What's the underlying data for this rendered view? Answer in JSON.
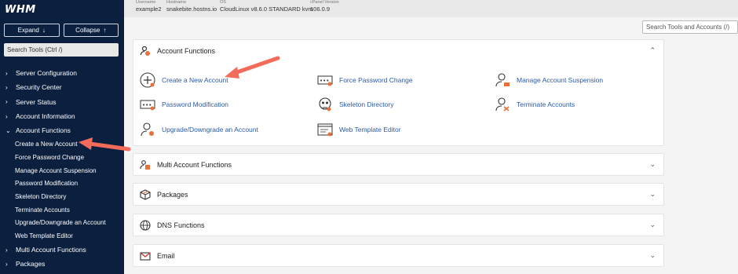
{
  "sidebar": {
    "logo": "WHM",
    "expand_label": "Expand",
    "collapse_label": "Collapse",
    "search_placeholder": "Search Tools (Ctrl /)",
    "items": [
      {
        "label": "Server Configuration"
      },
      {
        "label": "Security Center"
      },
      {
        "label": "Server Status"
      },
      {
        "label": "Account Information"
      },
      {
        "label": "Account Functions"
      }
    ],
    "sub_items": [
      {
        "label": "Create a New Account"
      },
      {
        "label": "Force Password Change"
      },
      {
        "label": "Manage Account Suspension"
      },
      {
        "label": "Password Modification"
      },
      {
        "label": "Skeleton Directory"
      },
      {
        "label": "Terminate Accounts"
      },
      {
        "label": "Upgrade/Downgrade an Account"
      },
      {
        "label": "Web Template Editor"
      }
    ],
    "items_after": [
      {
        "label": "Multi Account Functions"
      },
      {
        "label": "Packages"
      }
    ]
  },
  "topbar": {
    "username_label": "Username",
    "username": "example2",
    "hostname_label": "Hostname",
    "hostname": "snakebite.hostns.io",
    "os_label": "OS",
    "os": "CloudLinux v8.6.0 STANDARD kvm",
    "cpanel_label": "cPanel Version",
    "cpanel": "106.0.9"
  },
  "search": {
    "placeholder": "Search Tools and Accounts (/)"
  },
  "account_functions": {
    "title": "Account Functions",
    "items": [
      {
        "label": "Create a New Account",
        "icon": "add-user-icon"
      },
      {
        "label": "Force Password Change",
        "icon": "password-icon"
      },
      {
        "label": "Manage Account Suspension",
        "icon": "user-suspension-icon"
      },
      {
        "label": "Password Modification",
        "icon": "password-icon"
      },
      {
        "label": "Skeleton Directory",
        "icon": "skeleton-icon"
      },
      {
        "label": "Terminate Accounts",
        "icon": "terminate-user-icon"
      },
      {
        "label": "Upgrade/Downgrade an Account",
        "icon": "user-upgrade-icon"
      },
      {
        "label": "Web Template Editor",
        "icon": "web-template-icon"
      }
    ]
  },
  "panels": {
    "multi": "Multi Account Functions",
    "packages": "Packages",
    "dns": "DNS Functions",
    "email": "Email"
  },
  "colors": {
    "sidebar_bg": "#0b1f3f",
    "link": "#2a5aa8",
    "accent_orange": "#e8703a",
    "annotation_arrow": "#f26b5b"
  }
}
